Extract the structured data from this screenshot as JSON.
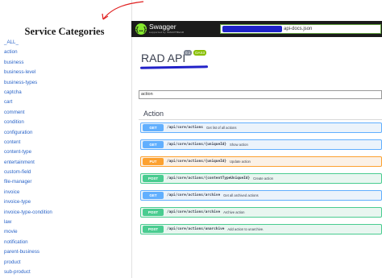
{
  "sidebar": {
    "title": "Service Categories",
    "items": [
      "_ALL_",
      "action",
      "business",
      "business-level",
      "business-types",
      "captcha",
      "cart",
      "comment",
      "condition",
      "configuration",
      "content",
      "content-type",
      "entertainment",
      "custom-field",
      "file-manager",
      "invoice",
      "invoice-type",
      "invoice-type-condition",
      "law",
      "movie",
      "notification",
      "parent-business",
      "product",
      "sub-product"
    ]
  },
  "header": {
    "brand": "Swagger",
    "brand_sub": "supported by SMARTBEAR",
    "logo_glyph": "{…}",
    "url_visible": "api-docs.json"
  },
  "api": {
    "title": "RAD API",
    "version": "0.1",
    "oas": "OAS3"
  },
  "filter": {
    "value": "action"
  },
  "section": {
    "title": "Action"
  },
  "operations": [
    {
      "method": "GET",
      "path": "/api/core/actions",
      "summary": "Get list of all actions"
    },
    {
      "method": "GET",
      "path": "/api/core/actions/{uniqueId}",
      "summary": "Show action"
    },
    {
      "method": "PUT",
      "path": "/api/core/actions/{uniqueId}",
      "summary": "Update action"
    },
    {
      "method": "POST",
      "path": "/api/core/actions/{contentTypeUniqueId}",
      "summary": "Create action"
    },
    {
      "method": "GET",
      "path": "/api/core/actions/archive",
      "summary": "Get all archived actions"
    },
    {
      "method": "POST",
      "path": "/api/core/actions/archive",
      "summary": "Archive action"
    },
    {
      "method": "POST",
      "path": "/api/core/actions/unarchive",
      "summary": "Add action to unarchive."
    }
  ],
  "colors": {
    "get": "#61affe",
    "put": "#fca130",
    "post": "#49cc90",
    "annotation_red": "#e02020",
    "annotation_blue": "#2222c8"
  }
}
